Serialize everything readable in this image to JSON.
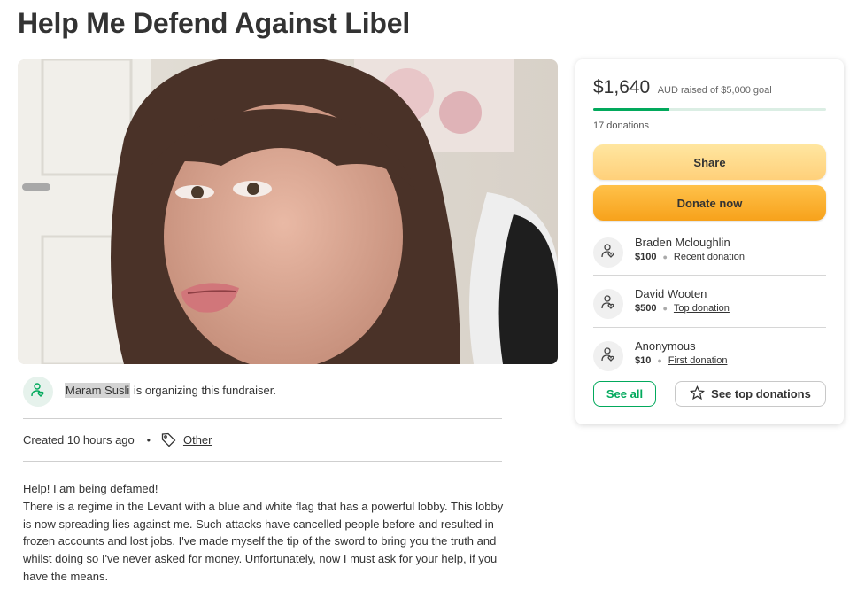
{
  "title": "Help Me Defend Against Libel",
  "organizer": {
    "name": "Maram Susli",
    "text": " is organizing this fundraiser."
  },
  "meta": {
    "created": "Created 10 hours ago",
    "dot": "•",
    "category": "Other"
  },
  "story": {
    "line1": "Help! I am being defamed!",
    "body": "There is a regime in the Levant with a blue and white flag that has a powerful lobby. This lobby is now spreading lies against me. Such attacks have cancelled people before and resulted in frozen accounts and lost jobs. I've made myself the tip of the sword to bring you the truth and whilst doing so I've never asked for money. Unfortunately, now I must ask for your help, if you have the means."
  },
  "card": {
    "amount": "$1,640",
    "goal_text": "AUD raised of $5,000 goal",
    "progress_fraction": 0.328,
    "donations_count": "17 donations",
    "share_label": "Share",
    "donate_label": "Donate now",
    "donors": [
      {
        "name": "Braden Mcloughlin",
        "amount": "$100",
        "tag": "Recent donation"
      },
      {
        "name": "David Wooten",
        "amount": "$500",
        "tag": "Top donation"
      },
      {
        "name": "Anonymous",
        "amount": "$10",
        "tag": "First donation"
      }
    ],
    "see_all_label": "See all",
    "see_top_label": "See top donations"
  },
  "colors": {
    "accent_green": "#02a95c",
    "donate_orange": "#f7a21b",
    "share_yellow": "#ffd07a"
  },
  "icons": [
    "user-heart-icon",
    "tag-icon",
    "star-icon"
  ]
}
